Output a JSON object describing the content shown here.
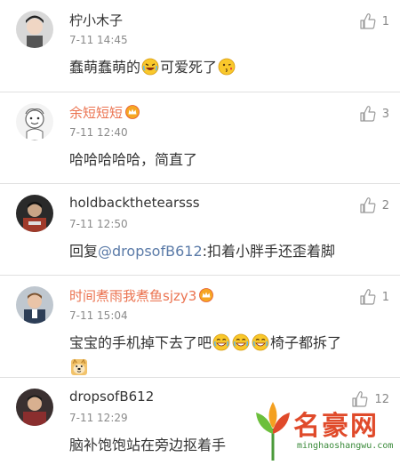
{
  "comments": [
    {
      "name": "柠小木子",
      "vip": false,
      "time": "7-11 14:45",
      "likes": "1",
      "text_parts": [
        "蠢萌蠢萌的",
        "可爱死了"
      ]
    },
    {
      "name": "余短短短",
      "vip": true,
      "time": "7-11 12:40",
      "likes": "3",
      "text": "哈哈哈哈哈，简直了"
    },
    {
      "name": "holdbackthetearsss",
      "vip": false,
      "time": "7-11 12:50",
      "likes": "2",
      "reply_prefix": "回复",
      "mention": "@dropsofB612",
      "reply_text": ":扣着小胖手还歪着脚"
    },
    {
      "name": "时间煮雨我煮鱼sjzy3",
      "vip": true,
      "time": "7-11 15:04",
      "likes": "1",
      "text_parts": [
        "宝宝的手机掉下去了吧",
        "椅子都拆了"
      ]
    },
    {
      "name": "dropsofB612",
      "vip": false,
      "time": "7-11 12:29",
      "likes": "12",
      "text": "脑补饱饱站在旁边抠着手"
    }
  ],
  "icons": {
    "like": "thumbs-up-icon",
    "vip": "vip-crown-icon"
  },
  "colors": {
    "vip_name": "#eb7350",
    "mention": "#5b7ba8",
    "watermark_red": "#e04a2a"
  },
  "watermark": {
    "title": "名豪网",
    "url": "minghaoshangwu.com"
  }
}
